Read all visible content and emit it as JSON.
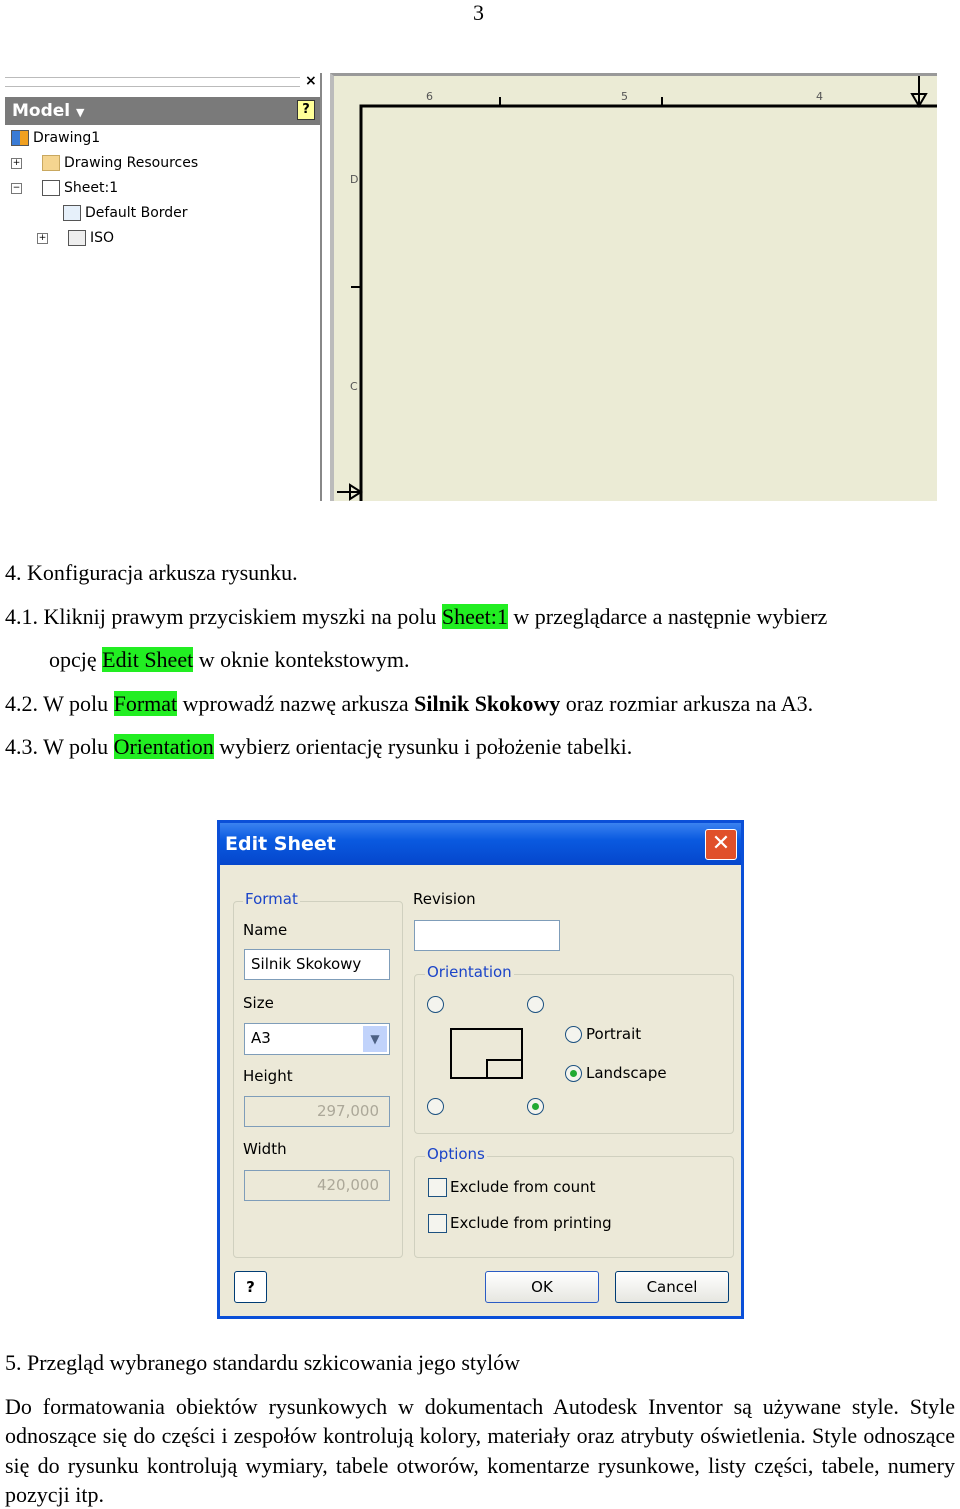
{
  "page_number": "3",
  "browser": {
    "title": "Model",
    "close": "×",
    "help": "?",
    "items": [
      {
        "label": "Drawing1"
      },
      {
        "label": "Drawing Resources"
      },
      {
        "label": "Sheet:1"
      },
      {
        "label": "Default Border"
      },
      {
        "label": "ISO"
      }
    ]
  },
  "drawing": {
    "col_labels": [
      "6",
      "5",
      "4"
    ],
    "row_labels": [
      "D",
      "C"
    ]
  },
  "section4": {
    "heading": "4.   Konfiguracja arkusza rysunku.",
    "s1": {
      "num": "4.1.",
      "a": " Kliknij prawym przyciskiem myszki na polu ",
      "h1": "Sheet:1",
      "b": " w przeglądarce a następnie wybierz",
      "c": "opcję ",
      "h2": "Edit Sheet",
      "d": " w oknie kontekstowym."
    },
    "s2": {
      "num": "4.2.",
      "a": " W polu ",
      "h1": "Format",
      "b": " wprowadź nazwę arkusza ",
      "bold": "Silnik Skokowy",
      "c": " oraz rozmiar arkusza na A3."
    },
    "s3": {
      "num": "4.3.",
      "a": " W polu ",
      "h1": "Orientation",
      "b": " wybierz orientację rysunku i położenie tabelki."
    }
  },
  "dialog": {
    "title": "Edit Sheet",
    "format_group": "Format",
    "name_label": "Name",
    "name_value": "Silnik Skokowy",
    "size_label": "Size",
    "size_value": "A3",
    "height_label": "Height",
    "height_value": "297,000",
    "width_label": "Width",
    "width_value": "420,000",
    "revision_label": "Revision",
    "revision_value": "",
    "orientation_group": "Orientation",
    "portrait": "Portrait",
    "landscape": "Landscape",
    "orientation_selected": "Landscape",
    "title_block_position_selected": "bottom-right",
    "options_group": "Options",
    "exclude_count": "Exclude from count",
    "exclude_printing": "Exclude from printing",
    "help": "?",
    "ok": "OK",
    "cancel": "Cancel"
  },
  "section5": {
    "heading": "5.   Przegląd wybranego standardu szkicowania jego stylów",
    "paragraph": "Do formatowania obiektów rysunkowych w dokumentach Autodesk Inventor są używane style. Style odnoszące się do części i zespołów kontrolują kolory, materiały oraz atrybuty oświetlenia. Style odnoszące się do rysunku kontrolują wymiary, tabele otworów, komentarze rysunkowe, listy części, tabele, numery pozycji itp."
  },
  "colors": {
    "highlight": "#22ee22",
    "titlebar": "#0a5ae0",
    "dialog_bg": "#ece9d8",
    "sheet_bg": "#ebebd5"
  }
}
